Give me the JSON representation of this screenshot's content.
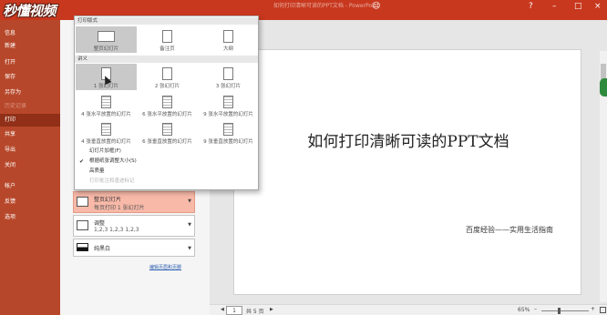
{
  "window": {
    "title": "如何打印清晰可读的PPT文档 - PowerPoint"
  },
  "watermark": {
    "text": "秒懂视频"
  },
  "sidebar": {
    "items": [
      {
        "label": "信息",
        "state": "normal"
      },
      {
        "label": "新建",
        "state": "normal"
      },
      {
        "label": "打开",
        "state": "normal"
      },
      {
        "label": "保存",
        "state": "normal"
      },
      {
        "label": "另存为",
        "state": "normal"
      },
      {
        "label": "历史记录",
        "state": "dim"
      },
      {
        "label": "打印",
        "state": "active"
      },
      {
        "label": "共享",
        "state": "normal"
      },
      {
        "label": "导出",
        "state": "normal"
      },
      {
        "label": "关闭",
        "state": "normal"
      },
      {
        "label": "帐户",
        "state": "normal"
      },
      {
        "label": "反馈",
        "state": "normal"
      },
      {
        "label": "选项",
        "state": "normal"
      }
    ]
  },
  "dropdown": {
    "layout_header": "打印版式",
    "layout_tiles": [
      {
        "label": "整页幻灯片",
        "selected": true
      },
      {
        "label": "备注页",
        "selected": false
      },
      {
        "label": "大纲",
        "selected": false
      }
    ],
    "handouts_header": "讲义",
    "handout_tiles": [
      {
        "label": "1 张幻灯片",
        "selected": true
      },
      {
        "label": "2 张幻灯片",
        "selected": false
      },
      {
        "label": "3 张幻灯片",
        "selected": false
      },
      {
        "label": "4 张水平放置的幻灯片",
        "selected": false
      },
      {
        "label": "6 张水平放置的幻灯片",
        "selected": false
      },
      {
        "label": "9 张水平放置的幻灯片",
        "selected": false
      },
      {
        "label": "4 张垂直放置的幻灯片",
        "selected": false
      },
      {
        "label": "6 张垂直放置的幻灯片",
        "selected": false
      },
      {
        "label": "9 张垂直放置的幻灯片",
        "selected": false
      }
    ],
    "options": [
      {
        "label": "幻灯片加框(F)",
        "checked": false,
        "enabled": true
      },
      {
        "label": "根据纸张调整大小(S)",
        "checked": true,
        "enabled": true
      },
      {
        "label": "高质量",
        "checked": false,
        "enabled": true
      },
      {
        "label": "打印批注和墨迹标记",
        "checked": false,
        "enabled": false
      }
    ]
  },
  "settings": {
    "layout_box": {
      "line1": "整页幻灯片",
      "line2": "每页打印 1 张幻灯片"
    },
    "collate_box": {
      "line1": "调整",
      "line2": "1,2,3    1,2,3    1,2,3"
    },
    "color_box": {
      "line1": "纯黑白"
    },
    "edit_header_footer": "编辑页眉和页脚"
  },
  "slide": {
    "title": "如何打印清晰可读的PPT文档",
    "subtitle": "百度经验——实用生活指南"
  },
  "statusbar": {
    "current_page": "1",
    "total_pages": "共 5 页",
    "zoom": "65%"
  }
}
